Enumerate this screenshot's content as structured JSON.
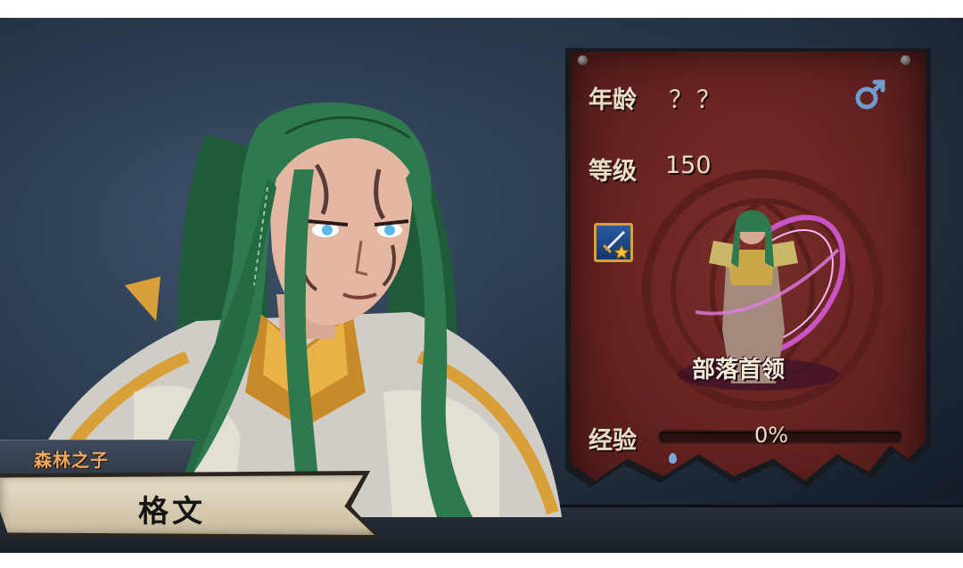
{
  "character": {
    "title": "森林之子",
    "name": "格文"
  },
  "stats": {
    "age_label": "年龄",
    "age_value": "？？",
    "level_label": "等级",
    "level_value": "150",
    "gender_icon": "male-symbol-icon",
    "skill_icon": "sword-star-icon",
    "class_name": "部落首领",
    "exp_label": "经验",
    "exp_value": "0%",
    "exp_fraction": 0
  },
  "colors": {
    "title_text": "#f0a860",
    "panel_bg": "#6a2522",
    "panel_text": "#e9dcc4",
    "gender_icon": "#6f9ccd",
    "hair": "#2e7a4e",
    "armor_gold": "#d9a03a"
  }
}
